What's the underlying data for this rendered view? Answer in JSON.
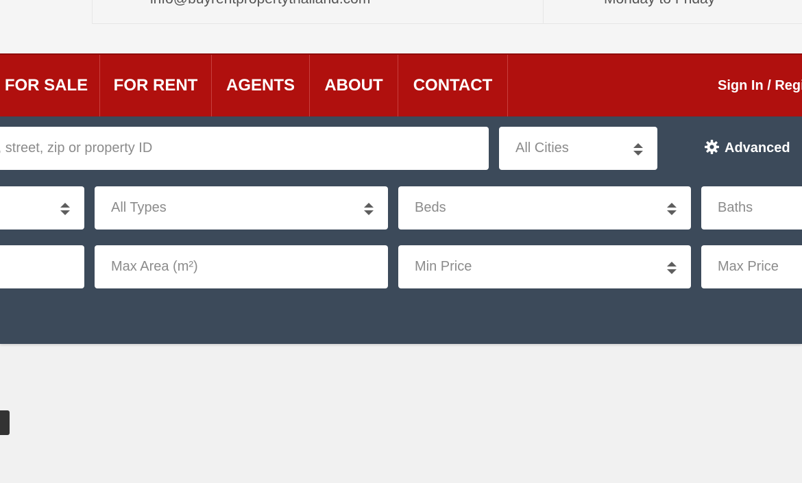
{
  "contact": {
    "email": "info@buyrentpropertythailand.com",
    "hours": "Monday to Friday"
  },
  "nav": {
    "items": [
      "FOR SALE",
      "FOR RENT",
      "AGENTS",
      "ABOUT",
      "CONTACT"
    ],
    "signin_label": "Sign In / Register"
  },
  "search": {
    "keyword_placeholder": "Enter an address, town, street, zip or property ID",
    "city_selected": "All Cities",
    "advanced_label": "Advanced",
    "status_selected": "",
    "type_selected": "All Types",
    "beds_selected": "Beds",
    "baths_selected": "Baths",
    "min_area_placeholder": "",
    "max_area_placeholder": "Max Area (m²)",
    "min_price_selected": "Min Price",
    "max_price_selected": "Max Price"
  },
  "icons": {
    "advanced": "gear-icon",
    "select": "sort-arrows-icon"
  },
  "colors": {
    "nav_bg": "#b0100e",
    "panel_bg": "#3c4a5a",
    "page_bg": "#f1f1f1"
  }
}
